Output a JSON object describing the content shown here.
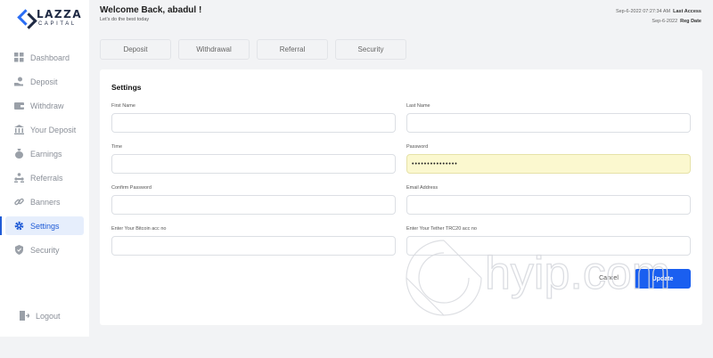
{
  "brand": {
    "name": "LAZZA",
    "sub": "CAPITAL"
  },
  "sidebar": {
    "items": [
      {
        "label": "Dashboard",
        "icon": "grid-icon"
      },
      {
        "label": "Deposit",
        "icon": "hand-coin-icon"
      },
      {
        "label": "Withdraw",
        "icon": "wallet-icon"
      },
      {
        "label": "Your Deposit",
        "icon": "bank-icon"
      },
      {
        "label": "Earnings",
        "icon": "money-bag-icon"
      },
      {
        "label": "Referrals",
        "icon": "users-icon"
      },
      {
        "label": "Banners",
        "icon": "link-icon"
      },
      {
        "label": "Settings",
        "icon": "gear-icon"
      },
      {
        "label": "Security",
        "icon": "shield-icon"
      }
    ],
    "active": "Settings",
    "logout": {
      "label": "Logout",
      "icon": "logout-icon"
    }
  },
  "header": {
    "welcome": "Welcome Back, abadul !",
    "tagline": "Let's do the best today",
    "last_access_value": "Sep-6-2022 07:27:34 AM",
    "last_access_label": "Last Access",
    "reg_date_value": "Sep-6-2022",
    "reg_date_label": "Reg Date"
  },
  "tabs": [
    "Deposit",
    "Withdrawal",
    "Referral",
    "Security"
  ],
  "settings": {
    "title": "Settings",
    "fields": {
      "first_name": {
        "label": "First Name",
        "value": ""
      },
      "last_name": {
        "label": "Last Name",
        "value": ""
      },
      "time": {
        "label": "Time",
        "value": ""
      },
      "password": {
        "label": "Password",
        "value": "•••••••••••••••"
      },
      "confirm_password": {
        "label": "Confirm Password",
        "value": ""
      },
      "email": {
        "label": "Email Address",
        "value": ""
      },
      "bitcoin": {
        "label": "Enter Your Bitcoin acc no",
        "value": ""
      },
      "tether": {
        "label": "Enter Your Tether TRC20 acc no",
        "value": ""
      }
    },
    "cancel_label": "Cancel",
    "update_label": "Update"
  },
  "watermark": {
    "text": "hyip.com"
  },
  "colors": {
    "accent": "#1a5ff0",
    "active_bg": "#e6eefc",
    "autofill_bg": "#fbf8cf"
  }
}
